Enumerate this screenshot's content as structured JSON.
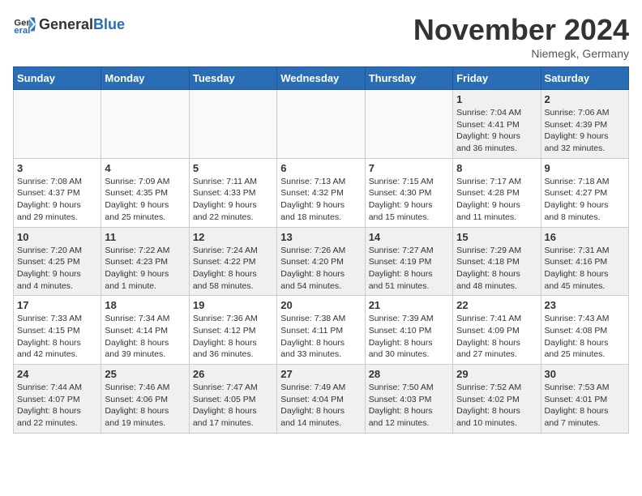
{
  "logo": {
    "general": "General",
    "blue": "Blue"
  },
  "title": "November 2024",
  "location": "Niemegk, Germany",
  "weekdays": [
    "Sunday",
    "Monday",
    "Tuesday",
    "Wednesday",
    "Thursday",
    "Friday",
    "Saturday"
  ],
  "weeks": [
    [
      {
        "day": "",
        "info": ""
      },
      {
        "day": "",
        "info": ""
      },
      {
        "day": "",
        "info": ""
      },
      {
        "day": "",
        "info": ""
      },
      {
        "day": "",
        "info": ""
      },
      {
        "day": "1",
        "info": "Sunrise: 7:04 AM\nSunset: 4:41 PM\nDaylight: 9 hours\nand 36 minutes."
      },
      {
        "day": "2",
        "info": "Sunrise: 7:06 AM\nSunset: 4:39 PM\nDaylight: 9 hours\nand 32 minutes."
      }
    ],
    [
      {
        "day": "3",
        "info": "Sunrise: 7:08 AM\nSunset: 4:37 PM\nDaylight: 9 hours\nand 29 minutes."
      },
      {
        "day": "4",
        "info": "Sunrise: 7:09 AM\nSunset: 4:35 PM\nDaylight: 9 hours\nand 25 minutes."
      },
      {
        "day": "5",
        "info": "Sunrise: 7:11 AM\nSunset: 4:33 PM\nDaylight: 9 hours\nand 22 minutes."
      },
      {
        "day": "6",
        "info": "Sunrise: 7:13 AM\nSunset: 4:32 PM\nDaylight: 9 hours\nand 18 minutes."
      },
      {
        "day": "7",
        "info": "Sunrise: 7:15 AM\nSunset: 4:30 PM\nDaylight: 9 hours\nand 15 minutes."
      },
      {
        "day": "8",
        "info": "Sunrise: 7:17 AM\nSunset: 4:28 PM\nDaylight: 9 hours\nand 11 minutes."
      },
      {
        "day": "9",
        "info": "Sunrise: 7:18 AM\nSunset: 4:27 PM\nDaylight: 9 hours\nand 8 minutes."
      }
    ],
    [
      {
        "day": "10",
        "info": "Sunrise: 7:20 AM\nSunset: 4:25 PM\nDaylight: 9 hours\nand 4 minutes."
      },
      {
        "day": "11",
        "info": "Sunrise: 7:22 AM\nSunset: 4:23 PM\nDaylight: 9 hours\nand 1 minute."
      },
      {
        "day": "12",
        "info": "Sunrise: 7:24 AM\nSunset: 4:22 PM\nDaylight: 8 hours\nand 58 minutes."
      },
      {
        "day": "13",
        "info": "Sunrise: 7:26 AM\nSunset: 4:20 PM\nDaylight: 8 hours\nand 54 minutes."
      },
      {
        "day": "14",
        "info": "Sunrise: 7:27 AM\nSunset: 4:19 PM\nDaylight: 8 hours\nand 51 minutes."
      },
      {
        "day": "15",
        "info": "Sunrise: 7:29 AM\nSunset: 4:18 PM\nDaylight: 8 hours\nand 48 minutes."
      },
      {
        "day": "16",
        "info": "Sunrise: 7:31 AM\nSunset: 4:16 PM\nDaylight: 8 hours\nand 45 minutes."
      }
    ],
    [
      {
        "day": "17",
        "info": "Sunrise: 7:33 AM\nSunset: 4:15 PM\nDaylight: 8 hours\nand 42 minutes."
      },
      {
        "day": "18",
        "info": "Sunrise: 7:34 AM\nSunset: 4:14 PM\nDaylight: 8 hours\nand 39 minutes."
      },
      {
        "day": "19",
        "info": "Sunrise: 7:36 AM\nSunset: 4:12 PM\nDaylight: 8 hours\nand 36 minutes."
      },
      {
        "day": "20",
        "info": "Sunrise: 7:38 AM\nSunset: 4:11 PM\nDaylight: 8 hours\nand 33 minutes."
      },
      {
        "day": "21",
        "info": "Sunrise: 7:39 AM\nSunset: 4:10 PM\nDaylight: 8 hours\nand 30 minutes."
      },
      {
        "day": "22",
        "info": "Sunrise: 7:41 AM\nSunset: 4:09 PM\nDaylight: 8 hours\nand 27 minutes."
      },
      {
        "day": "23",
        "info": "Sunrise: 7:43 AM\nSunset: 4:08 PM\nDaylight: 8 hours\nand 25 minutes."
      }
    ],
    [
      {
        "day": "24",
        "info": "Sunrise: 7:44 AM\nSunset: 4:07 PM\nDaylight: 8 hours\nand 22 minutes."
      },
      {
        "day": "25",
        "info": "Sunrise: 7:46 AM\nSunset: 4:06 PM\nDaylight: 8 hours\nand 19 minutes."
      },
      {
        "day": "26",
        "info": "Sunrise: 7:47 AM\nSunset: 4:05 PM\nDaylight: 8 hours\nand 17 minutes."
      },
      {
        "day": "27",
        "info": "Sunrise: 7:49 AM\nSunset: 4:04 PM\nDaylight: 8 hours\nand 14 minutes."
      },
      {
        "day": "28",
        "info": "Sunrise: 7:50 AM\nSunset: 4:03 PM\nDaylight: 8 hours\nand 12 minutes."
      },
      {
        "day": "29",
        "info": "Sunrise: 7:52 AM\nSunset: 4:02 PM\nDaylight: 8 hours\nand 10 minutes."
      },
      {
        "day": "30",
        "info": "Sunrise: 7:53 AM\nSunset: 4:01 PM\nDaylight: 8 hours\nand 7 minutes."
      }
    ]
  ]
}
